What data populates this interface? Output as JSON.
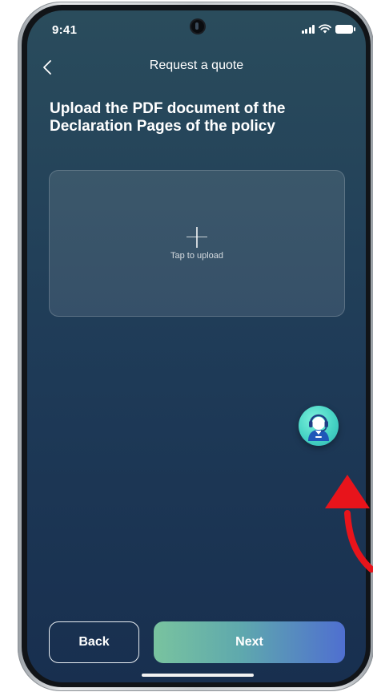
{
  "status_bar": {
    "time": "9:41",
    "icons": [
      "signal-icon",
      "wifi-icon",
      "battery-icon"
    ]
  },
  "nav": {
    "back_icon": "chevron-left-icon",
    "title": "Request a quote"
  },
  "page": {
    "heading": "Upload the PDF document of the Declaration Pages of the policy"
  },
  "upload": {
    "icon": "plus-icon",
    "label": "Tap to upload"
  },
  "support": {
    "icon": "customer-support-agent-icon",
    "color": "#46d3c4"
  },
  "footer": {
    "back_label": "Back",
    "next_label": "Next"
  },
  "annotation": {
    "icon": "curved-arrow-icon",
    "color": "#e8141b"
  },
  "colors": {
    "background_top": "#2a4c5c",
    "background_bottom": "#182f4f",
    "next_gradient_start": "#79c39f",
    "next_gradient_end": "#4f6fd0"
  }
}
